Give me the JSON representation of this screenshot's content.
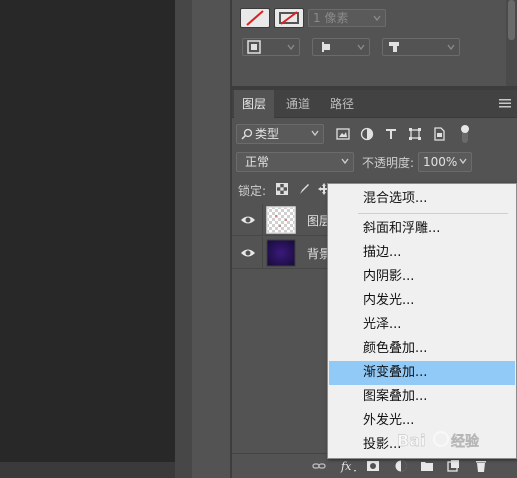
{
  "properties": {
    "stroke_width": "1 像素",
    "icons": [
      "no-fill-swatch",
      "no-stroke-swatch",
      "path-ops",
      "path-align",
      "path-arrange"
    ]
  },
  "layers_panel": {
    "tabs": [
      "图层",
      "通道",
      "路径"
    ],
    "active_tab": "图层",
    "filter_label": "类型",
    "blend_mode": "正常",
    "opacity_label": "不透明度:",
    "opacity_value": "100%",
    "lock_label": "锁定:",
    "layers": [
      {
        "name": "图层",
        "visible": true,
        "thumb": "transparent"
      },
      {
        "name": "背景",
        "visible": true,
        "thumb": "purple-gradient"
      }
    ],
    "bottom_icons": [
      "link-icon",
      "fx-icon",
      "mask-icon",
      "adjustment-icon",
      "group-icon",
      "new-layer-icon",
      "trash-icon"
    ]
  },
  "context_menu": {
    "items": [
      "混合选项...",
      "斜面和浮雕...",
      "描边...",
      "内阴影...",
      "内发光...",
      "光泽...",
      "颜色叠加...",
      "渐变叠加...",
      "图案叠加...",
      "外发光...",
      "投影..."
    ],
    "highlighted": "渐变叠加..."
  },
  "colors": {
    "panel": "#535353",
    "canvas": "#282828",
    "menu_bg": "#f0f0f0",
    "menu_highlight": "#91c9f7"
  }
}
